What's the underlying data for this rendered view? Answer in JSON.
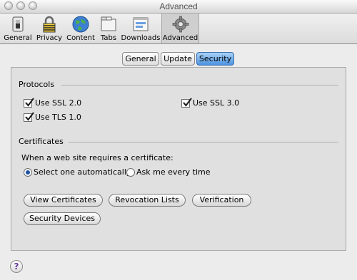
{
  "window": {
    "title": "Advanced"
  },
  "toolbar": {
    "items": [
      {
        "label": "General",
        "icon": "switch-icon"
      },
      {
        "label": "Privacy",
        "icon": "padlock-icon"
      },
      {
        "label": "Content",
        "icon": "globe-icon"
      },
      {
        "label": "Tabs",
        "icon": "tabs-icon"
      },
      {
        "label": "Downloads",
        "icon": "downloads-window-icon"
      },
      {
        "label": "Advanced",
        "icon": "gear-icon",
        "selected": true
      }
    ]
  },
  "tabs": [
    {
      "label": "General"
    },
    {
      "label": "Update"
    },
    {
      "label": "Security",
      "active": true
    }
  ],
  "protocols": {
    "heading": "Protocols",
    "ssl2": {
      "label": "Use SSL 2.0",
      "checked": true
    },
    "ssl3": {
      "label": "Use SSL 3.0",
      "checked": true
    },
    "tls1": {
      "label": "Use TLS 1.0",
      "checked": true
    }
  },
  "certificates": {
    "heading": "Certificates",
    "prompt": "When a web site requires a certificate:",
    "options": [
      {
        "label": "Select one automatically",
        "selected": true
      },
      {
        "label": "Ask me every time",
        "selected": false
      }
    ],
    "buttons": {
      "view": "View Certificates",
      "revocation": "Revocation Lists",
      "verification": "Verification",
      "devices": "Security Devices"
    }
  },
  "help": {
    "label": "?"
  },
  "colors": {
    "accent": "#4d93e0",
    "panel": "#e0e0e0",
    "background": "#ececec"
  }
}
